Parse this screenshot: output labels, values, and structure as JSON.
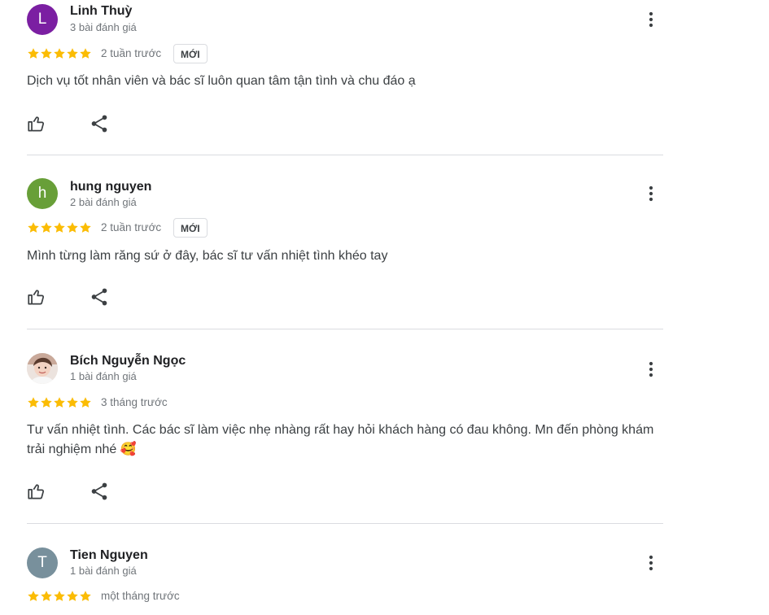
{
  "colors": {
    "star": "#fbbc04",
    "avatar_linh": "#7b1fa2",
    "avatar_hung": "#689f38",
    "avatar_tien": "#78909c"
  },
  "reviews": [
    {
      "avatar_letter": "L",
      "name": "Linh Thuỳ",
      "review_count": "3 bài đánh giá",
      "rating": 5,
      "time": "2 tuần trước",
      "badge": "MỚI",
      "text": "Dịch vụ tốt nhân viên và bác sĩ luôn quan tâm tận tình và chu đáo ạ"
    },
    {
      "avatar_letter": "h",
      "name": "hung nguyen",
      "review_count": "2 bài đánh giá",
      "rating": 5,
      "time": "2 tuần trước",
      "badge": "MỚI",
      "text": "Mình từng làm răng sứ ở đây, bác sĩ tư vấn nhiệt tình khéo tay"
    },
    {
      "avatar_letter": "",
      "name": "Bích Nguyễn Ngọc",
      "review_count": "1 bài đánh giá",
      "rating": 5,
      "time": "3 tháng trước",
      "text": "Tư vấn nhiệt tình. Các bác sĩ làm việc nhẹ nhàng rất hay hỏi khách hàng có đau không. Mn đến phòng khám trải nghiệm nhé 🥰"
    },
    {
      "avatar_letter": "T",
      "name": "Tien Nguyen",
      "review_count": "1 bài đánh giá",
      "rating": 5,
      "time": "một tháng trước"
    }
  ],
  "icons": {
    "more": "more-vert-icon",
    "like": "thumb-up-icon",
    "share": "share-icon",
    "star": "star-icon"
  }
}
